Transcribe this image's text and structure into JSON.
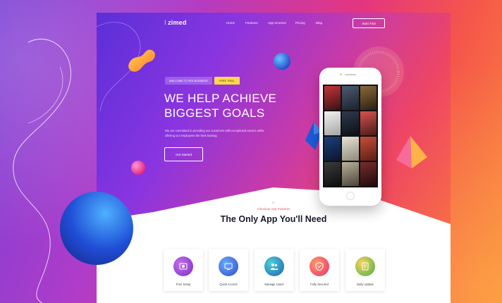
{
  "nav": {
    "logo": "zimed",
    "items": [
      "Home",
      "Features",
      "App Screens",
      "Pricing",
      "Blog"
    ],
    "cta": "Start Trial"
  },
  "hero": {
    "badge_welcome": "WELCOME TO SEN BUSINESS",
    "badge_trial": "FREE TRIAL",
    "title_line1": "WE HELP ACHIEVE",
    "title_line2": "BIGGEST GOALS",
    "description": "We are committed to providing our customers with exceptional service while offering our employees the best training.",
    "button": "Get Started"
  },
  "section": {
    "sub_label": "Checkout App Features",
    "title": "The Only App You'll Need"
  },
  "features": [
    {
      "label": "Free Setup",
      "icon": "setup-icon",
      "color": "#7b2fc6"
    },
    {
      "label": "Quick Access",
      "icon": "monitor-icon",
      "color": "#2d6fd8"
    },
    {
      "label": "Manage Users",
      "icon": "users-icon",
      "color": "#1e8fb8"
    },
    {
      "label": "Fully Secured",
      "icon": "shield-icon",
      "color": "#f0455c"
    },
    {
      "label": "Daily Update",
      "icon": "update-icon",
      "color": "#3fb04a"
    }
  ],
  "colors": {
    "accent_red": "#f04e62",
    "trial_yellow": "#ffd84a",
    "title_dark": "#1a1a2e"
  }
}
